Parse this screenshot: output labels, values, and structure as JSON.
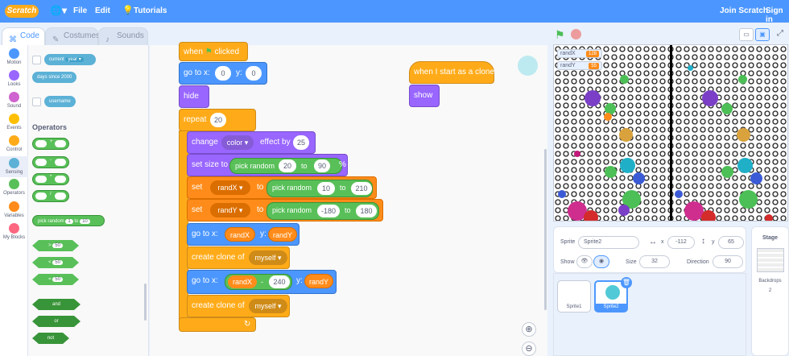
{
  "menubar": {
    "logo": "Scratch",
    "file": "File",
    "edit": "Edit",
    "tutorials": "Tutorials",
    "join": "Join Scratch",
    "signin": "Sign in"
  },
  "tabs": {
    "code": "Code",
    "costumes": "Costumes",
    "sounds": "Sounds"
  },
  "categories": [
    {
      "label": "Motion",
      "color": "#4c97ff"
    },
    {
      "label": "Looks",
      "color": "#9966ff"
    },
    {
      "label": "Sound",
      "color": "#cf63cf"
    },
    {
      "label": "Events",
      "color": "#ffbf00"
    },
    {
      "label": "Control",
      "color": "#ffab19"
    },
    {
      "label": "Sensing",
      "color": "#5cb1d6"
    },
    {
      "label": "Operators",
      "color": "#59c059"
    },
    {
      "label": "Variables",
      "color": "#ff8c1a"
    },
    {
      "label": "My Blocks",
      "color": "#ff6680"
    }
  ],
  "palette": {
    "current": "current",
    "year": "year ▾",
    "days": "days since 2000",
    "username": "username",
    "operators_title": "Operators",
    "plus": "+",
    "minus": "-",
    "times": "*",
    "divide": "/",
    "pick_random": "pick random",
    "pick_from": "1",
    "pick_to": "to",
    "pick_to_val": "10",
    "gt": ">",
    "lt": "<",
    "eq": "=",
    "gt_val": "50",
    "lt_val": "50",
    "eq_val": "50",
    "and": "and",
    "or": "or",
    "not": "not"
  },
  "script1": {
    "hat": "when",
    "hat2": "clicked",
    "goto_label": "go to x:",
    "goto_x": "0",
    "goto_y_label": "y:",
    "goto_y": "0",
    "hide": "hide",
    "repeat": "repeat",
    "repeat_val": "20",
    "change": "change",
    "effect": "color ▾",
    "effect_by": "effect by",
    "effect_val": "25",
    "setsize": "set size to",
    "pick": "pick random",
    "size_from": "20",
    "to": "to",
    "size_to": "90",
    "pct": "%",
    "set": "set",
    "randx_var": "randX ▾",
    "setx_to": "to",
    "x_from": "10",
    "x_to": "210",
    "randy_var": "randY ▾",
    "y_from": "-180",
    "y_to": "180",
    "goto2_label": "go to x:",
    "randx": "randX",
    "y_label": "y:",
    "randy": "randY",
    "clone": "create clone of",
    "myself": "myself ▾",
    "goto3_label": "go to x:",
    "minus": "-",
    "minus_val": "240"
  },
  "script2": {
    "hat": "when I start as a clone",
    "show": "show"
  },
  "stage": {
    "randx_label": "randX",
    "randx_val": "128",
    "randy_label": "randY",
    "randy_val": "55"
  },
  "sprite_info": {
    "sprite_label": "Sprite",
    "sprite_name": "Sprite2",
    "x_label": "x",
    "x_val": "-112",
    "y_label": "y",
    "y_val": "65",
    "show_label": "Show",
    "size_label": "Size",
    "size_val": "32",
    "dir_label": "Direction",
    "dir_val": "90"
  },
  "sprites": [
    {
      "name": "Sprite1"
    },
    {
      "name": "Sprite2"
    }
  ],
  "stage_panel": {
    "title": "Stage",
    "backdrops": "Backdrops",
    "count": "2"
  }
}
